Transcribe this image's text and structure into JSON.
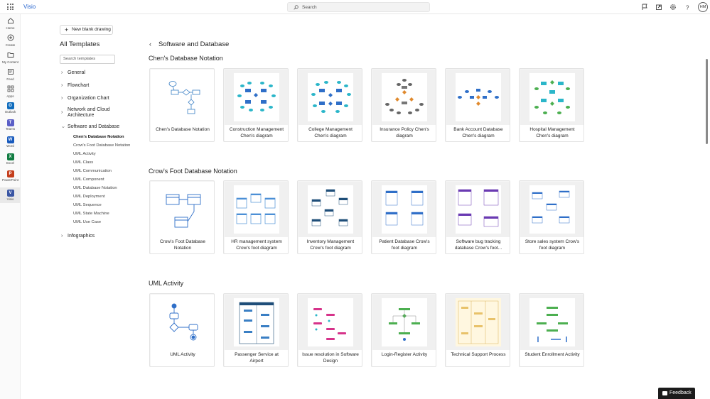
{
  "app": {
    "name": "Visio",
    "search_placeholder": "Search",
    "avatar_initials": "HM"
  },
  "rail": [
    {
      "label": "Home",
      "icon": "home-icon"
    },
    {
      "label": "Create",
      "icon": "create-icon"
    },
    {
      "label": "My Content",
      "icon": "folder-icon"
    },
    {
      "label": "Feed",
      "icon": "feed-icon"
    },
    {
      "label": "Apps",
      "icon": "apps-icon"
    },
    {
      "label": "Outlook",
      "icon": "outlook-icon",
      "letter": "O",
      "color": "#0f6cbd"
    },
    {
      "label": "Teams",
      "icon": "teams-icon",
      "letter": "T",
      "color": "#5b5fc7"
    },
    {
      "label": "Word",
      "icon": "word-icon",
      "letter": "W",
      "color": "#185abd"
    },
    {
      "label": "Excel",
      "icon": "excel-icon",
      "letter": "X",
      "color": "#107c41"
    },
    {
      "label": "PowerPoint",
      "icon": "powerpoint-icon",
      "letter": "P",
      "color": "#c43e1c"
    },
    {
      "label": "Visio",
      "icon": "visio-icon",
      "letter": "V",
      "color": "#3955a3"
    }
  ],
  "left": {
    "new_blank": "New blank drawing",
    "title": "All Templates",
    "search_placeholder": "Search templates",
    "categories": [
      {
        "label": "General"
      },
      {
        "label": "Flowchart"
      },
      {
        "label": "Organization Chart"
      },
      {
        "label": "Network and Cloud Architecture",
        "line1": "Network and Cloud",
        "line2": "Architecture"
      },
      {
        "label": "Software and Database"
      },
      {
        "label": "Infographics"
      }
    ],
    "subitems": [
      "Chen's Database Notation",
      "Crow's Foot Database Notation",
      "UML Activity",
      "UML Class",
      "UML Communication",
      "UML Component",
      "UML Database Notation",
      "UML Deployment",
      "UML Sequence",
      "UML State Machine",
      "UML Use Case"
    ]
  },
  "main": {
    "back": "‹",
    "title": "Software and Database",
    "sections": [
      {
        "title": "Chen's Database Notation",
        "cards": [
          {
            "line1": "Chen's Database Notation",
            "line2": ""
          },
          {
            "line1": "Construction Management",
            "line2": "Chen's diagram"
          },
          {
            "line1": "College Management",
            "line2": "Chen's diagram"
          },
          {
            "line1": "Insurance Policy Chen's",
            "line2": "diagram"
          },
          {
            "line1": "Bank Account Database",
            "line2": "Chen's diagram"
          },
          {
            "line1": "Hospital Management",
            "line2": "Chen's diagram"
          }
        ]
      },
      {
        "title": "Crow's Foot Database Notation",
        "cards": [
          {
            "line1": "Crow's Foot Database",
            "line2": "Notation"
          },
          {
            "line1": "HR management system",
            "line2": "Crow's foot diagram"
          },
          {
            "line1": "Inventory Management",
            "line2": "Crow's foot diagram"
          },
          {
            "line1": "Patient Database Crow's",
            "line2": "foot diagram"
          },
          {
            "line1": "Software bug tracking",
            "line2": "database Crow's foot..."
          },
          {
            "line1": "Store sales system Crow's",
            "line2": "foot diagram"
          }
        ]
      },
      {
        "title": "UML Activity",
        "cards": [
          {
            "line1": "UML Activity",
            "line2": ""
          },
          {
            "line1": "Passenger Service at",
            "line2": "Airport"
          },
          {
            "line1": "Issue resolution in Software",
            "line2": "Design"
          },
          {
            "line1": "Login-Register Activity",
            "line2": ""
          },
          {
            "line1": "Technical Support Process",
            "line2": ""
          },
          {
            "line1": "Student Enrollment Activity",
            "line2": ""
          }
        ]
      }
    ]
  },
  "feedback": "Feedback",
  "colors": {
    "accent": "#2564cf",
    "diagram_blue": "#4b8fd6",
    "diagram_teal": "#2bb6c9",
    "diagram_green": "#4caf50",
    "diagram_orange": "#e08a2e",
    "diagram_purple": "#6a3ab2",
    "diagram_pink": "#d6338a"
  }
}
